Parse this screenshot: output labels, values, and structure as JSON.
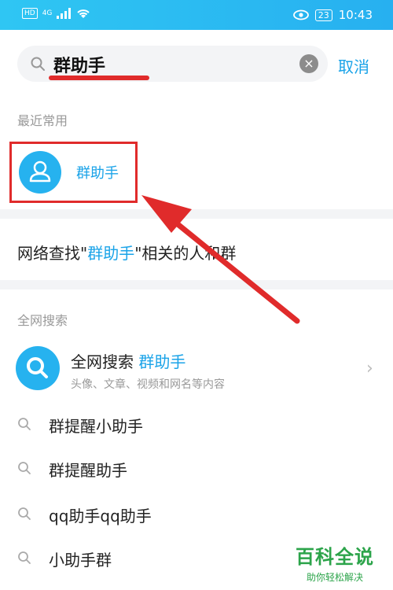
{
  "status_bar": {
    "signal_label": "HD",
    "network_label": "4G",
    "battery_label": "23",
    "time": "10:43"
  },
  "search": {
    "query": "群助手",
    "cancel_label": "取消"
  },
  "recent": {
    "title": "最近常用",
    "items": [
      {
        "label": "群助手"
      }
    ]
  },
  "network_find": {
    "prefix": "网络查找\"",
    "keyword": "群助手",
    "suffix": "\"相关的人和群"
  },
  "web_search": {
    "section_title": "全网搜索",
    "title_prefix": "全网搜索 ",
    "keyword": "群助手",
    "subtitle": "头像、文章、视频和网名等内容"
  },
  "suggestions": [
    {
      "text": "群提醒小助手"
    },
    {
      "text": "群提醒助手"
    },
    {
      "text": "qq助手qq助手"
    },
    {
      "text": "小助手群"
    }
  ],
  "watermark": {
    "main": "百科全说",
    "sub": "助你轻松解决"
  },
  "colors": {
    "accent": "#1aa3e8",
    "highlight_red": "#e02b2b",
    "watermark_green": "#2ca44a"
  }
}
